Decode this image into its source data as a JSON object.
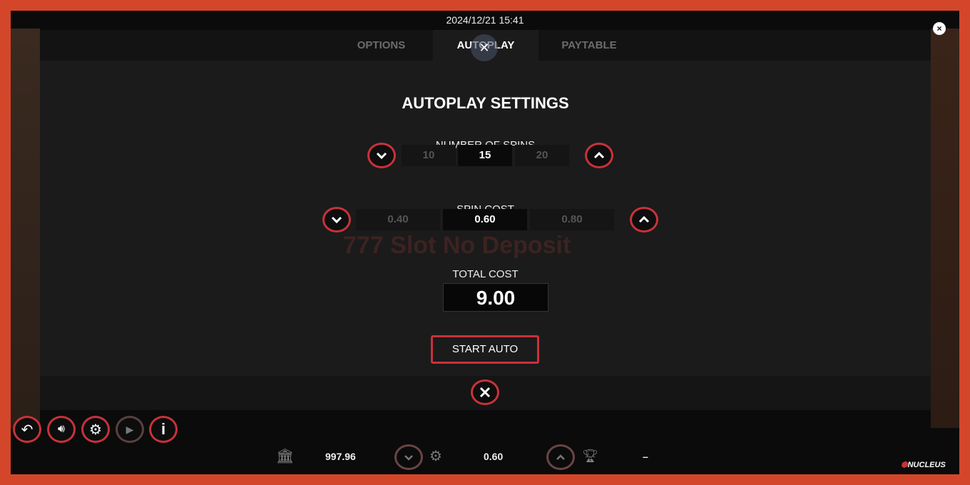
{
  "datetime": "2024/12/21 15:41",
  "tabs": [
    {
      "label": "OPTIONS"
    },
    {
      "label": "AUTOPLAY",
      "active": true
    },
    {
      "label": "PAYTABLE"
    }
  ],
  "title": "AUTOPLAY SETTINGS",
  "spins": {
    "label": "NUMBER OF SPINS",
    "options": [
      "10",
      "15",
      "20"
    ],
    "selected": "15"
  },
  "spin_cost": {
    "label": "SPIN COST",
    "options": [
      "0.40",
      "0.60",
      "0.80"
    ],
    "selected": "0.60"
  },
  "total_cost": {
    "label": "TOTAL COST",
    "value": "9.00"
  },
  "start_label": "START AUTO",
  "watermark": "777 Slot No Deposit",
  "footer": {
    "balance": "997.96",
    "bet": "0.60",
    "win": "–",
    "brand": "NUCLEUS"
  },
  "colors": {
    "accent": "#c8323a",
    "frame": "#d4462a"
  }
}
